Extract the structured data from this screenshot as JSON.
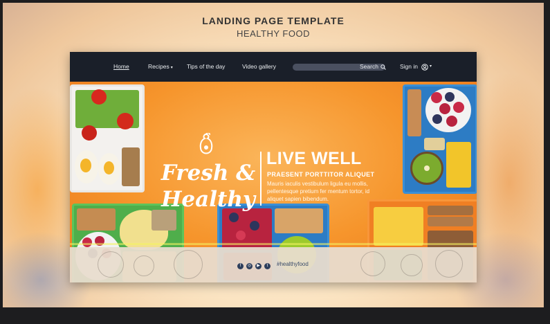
{
  "header": {
    "title": "LANDING PAGE TEMPLATE",
    "subtitle": "HEALTHY FOOD"
  },
  "nav": {
    "items": [
      {
        "label": "Home",
        "active": true
      },
      {
        "label": "Recipes",
        "has_dropdown": true
      },
      {
        "label": "Tips of the day"
      },
      {
        "label": "Video gallery"
      }
    ],
    "search_label": "Search",
    "signin_label": "Sign in"
  },
  "hero": {
    "brand_line1": "Fresh &",
    "brand_line2": "Healthy",
    "headline": "LIVE WELL",
    "subheadline": "PRAESENT PORTTITOR ALIQUET",
    "body": "Mauris iaculis vestibulum ligula eu mollis, pellentesque pretium fer mentum tortor, id aliquet sapien bibendum."
  },
  "footer": {
    "hashtag": "#healthyfood",
    "social_icons": [
      "facebook-icon",
      "instagram-icon",
      "youtube-icon",
      "twitter-icon"
    ]
  },
  "colors": {
    "nav_bg": "#1a1f29",
    "hero_orange": "#f6952c",
    "footer_bg": "#e8dccd",
    "text_dark": "#333333"
  }
}
